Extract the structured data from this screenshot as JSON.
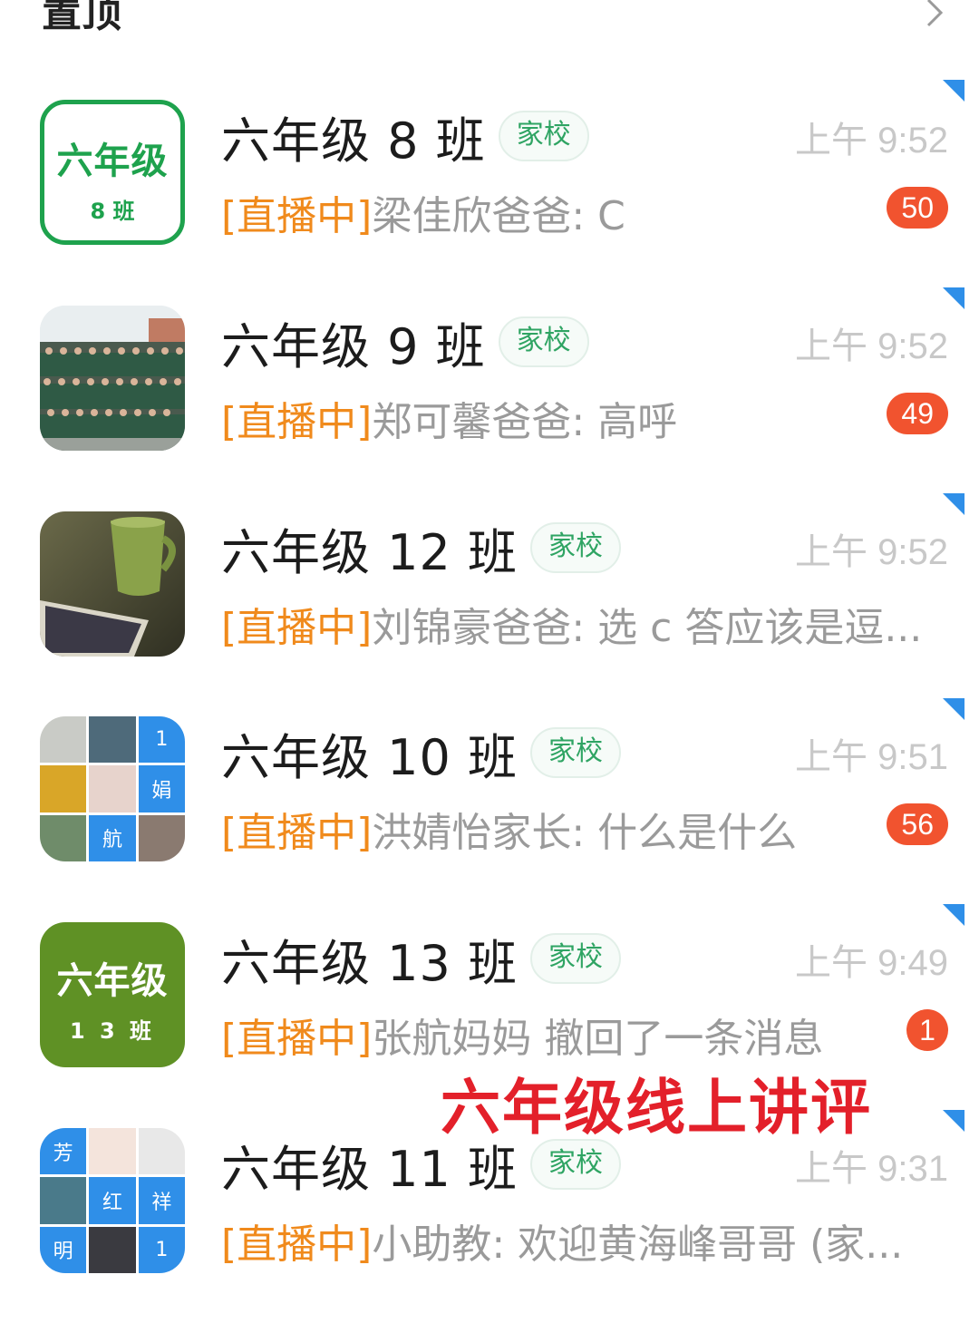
{
  "section": {
    "title": "置顶"
  },
  "chats": [
    {
      "name": "六年级 8 班",
      "tag": "家校",
      "time": "上午 9:52",
      "live": "[直播中]",
      "message": "梁佳欣爸爸: C",
      "badge": "50",
      "avatar": {
        "line1": "六年级",
        "line2": "8 班"
      }
    },
    {
      "name": "六年级 9 班",
      "tag": "家校",
      "time": "上午 9:52",
      "live": "[直播中]",
      "message": "郑可馨爸爸: 高呼",
      "badge": "49"
    },
    {
      "name": "六年级 12 班",
      "tag": "家校",
      "time": "上午 9:52",
      "live": "[直播中]",
      "message": "刘锦豪爸爸: 选 c 答应该是逗...",
      "badge": ""
    },
    {
      "name": "六年级 10 班",
      "tag": "家校",
      "time": "上午 9:51",
      "live": "[直播中]",
      "message": "洪婧怡家长: 什么是什么",
      "badge": "56",
      "avatar": {
        "cells": [
          "",
          "",
          "1",
          "",
          "",
          "娟",
          "",
          "航",
          ""
        ]
      }
    },
    {
      "name": "六年级 13 班",
      "tag": "家校",
      "time": "上午 9:49",
      "live": "[直播中]",
      "message": "张航妈妈 撤回了一条消息",
      "badge": "1",
      "avatar": {
        "line1": "六年级",
        "line2": "1 3 班"
      }
    },
    {
      "name": "六年级 11 班",
      "tag": "家校",
      "time": "上午 9:31",
      "live": "[直播中]",
      "message": "小助教: 欢迎黄海峰哥哥 (家...",
      "badge": "",
      "avatar": {
        "cells": [
          "芳",
          "",
          "",
          "",
          "红",
          "祥",
          "明",
          "",
          "1"
        ]
      }
    }
  ],
  "overlay": {
    "caption": "六年级线上讲评"
  },
  "colors": {
    "live": "#f08a1c",
    "badge": "#f1532f",
    "tag": "#2fa463",
    "pin": "#2f8fe8"
  }
}
